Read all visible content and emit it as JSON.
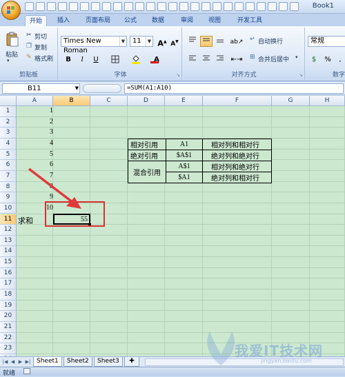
{
  "window": {
    "title": "Book1"
  },
  "tabs": [
    "开始",
    "插入",
    "页面布局",
    "公式",
    "数据",
    "审阅",
    "视图",
    "开发工具"
  ],
  "active_tab": "开始",
  "ribbon": {
    "clipboard": {
      "paste": "粘贴",
      "cut": "剪切",
      "copy": "复制",
      "format_painter": "格式刷",
      "group_label": "剪贴板"
    },
    "font": {
      "font_name": "Times New Roman",
      "font_size": "11",
      "bold": "B",
      "italic": "I",
      "underline": "U",
      "grow": "A",
      "shrink": "A",
      "color_letter": "A",
      "group_label": "字体"
    },
    "alignment": {
      "wrap_text": "自动换行",
      "merge_center": "合并后居中",
      "group_label": "对齐方式"
    },
    "number": {
      "format": "常规",
      "percent": "%",
      "comma": ",",
      "group_label": "数字"
    }
  },
  "formula_bar": {
    "name_box": "B11",
    "formula": "=SUM(A1:A10)"
  },
  "columns": [
    "A",
    "B",
    "C",
    "D",
    "E",
    "F",
    "G",
    "H"
  ],
  "selected_column": "B",
  "rows": [
    "1",
    "2",
    "3",
    "4",
    "5",
    "6",
    "7",
    "8",
    "9",
    "10",
    "11",
    "12",
    "13",
    "14",
    "15",
    "16",
    "17",
    "18",
    "19",
    "20",
    "21",
    "22",
    "23",
    "24"
  ],
  "selected_row": "11",
  "cells": {
    "a_values": [
      "1",
      "2",
      "3",
      "4",
      "5",
      "6",
      "7",
      "8",
      "9",
      "10"
    ],
    "a11": "求和",
    "b11": "55"
  },
  "reference_table": {
    "rows": [
      {
        "type": "相对引用",
        "ref": "A1",
        "desc": "相对列和相对行"
      },
      {
        "type": "绝对引用",
        "ref": "$A$1",
        "desc": "绝对列和绝对行"
      },
      {
        "type": "混合引用",
        "ref": "A$1",
        "desc": "相对列和绝对行"
      },
      {
        "type": "",
        "ref": "$A1",
        "desc": "绝对列和相对行"
      }
    ]
  },
  "sheets": [
    "Sheet1",
    "Sheet2",
    "Sheet3"
  ],
  "active_sheet": "Sheet1",
  "status": {
    "text": "就绪"
  },
  "watermark": {
    "line1": "我爱IT技术网",
    "line2": "jingyan.baidu.com"
  },
  "colors": {
    "grid_bg": "#cce8cf",
    "highlight": "#d93030",
    "arrow": "#e03a3a"
  }
}
